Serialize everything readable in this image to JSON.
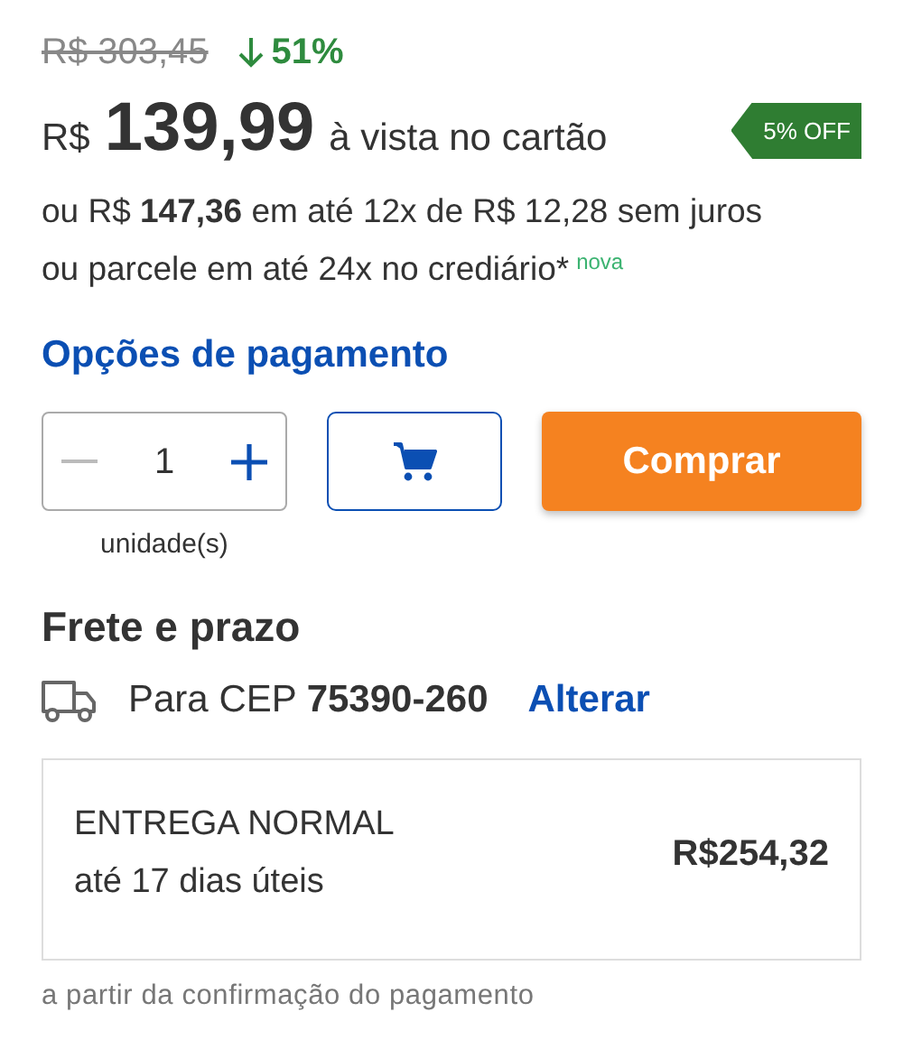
{
  "old_price": "R$ 303,45",
  "discount": "51%",
  "price": {
    "currency": "R$",
    "amount": "139,99",
    "condition": "à vista no cartão",
    "badge": "5% OFF"
  },
  "installments": "ou R$ **147,36** em até 12x de R$ 12,28 sem juros",
  "credit": {
    "text": "ou parcele em até 24x no crediário*",
    "tag": "nova"
  },
  "payment_options_link": "Opções de pagamento",
  "quantity": {
    "value": "1",
    "decrement_disabled": true,
    "unit_label": "unidade(s)"
  },
  "buy_button": "Comprar",
  "shipping": {
    "title": "Frete e prazo",
    "cep": "Para CEP **75390-260**",
    "change_link": "Alterar",
    "option": {
      "name": "ENTREGA NORMAL",
      "deadline": "até 17 dias úteis",
      "price": "R$254,32"
    },
    "note": "a partir da confirmação do pagamento"
  }
}
